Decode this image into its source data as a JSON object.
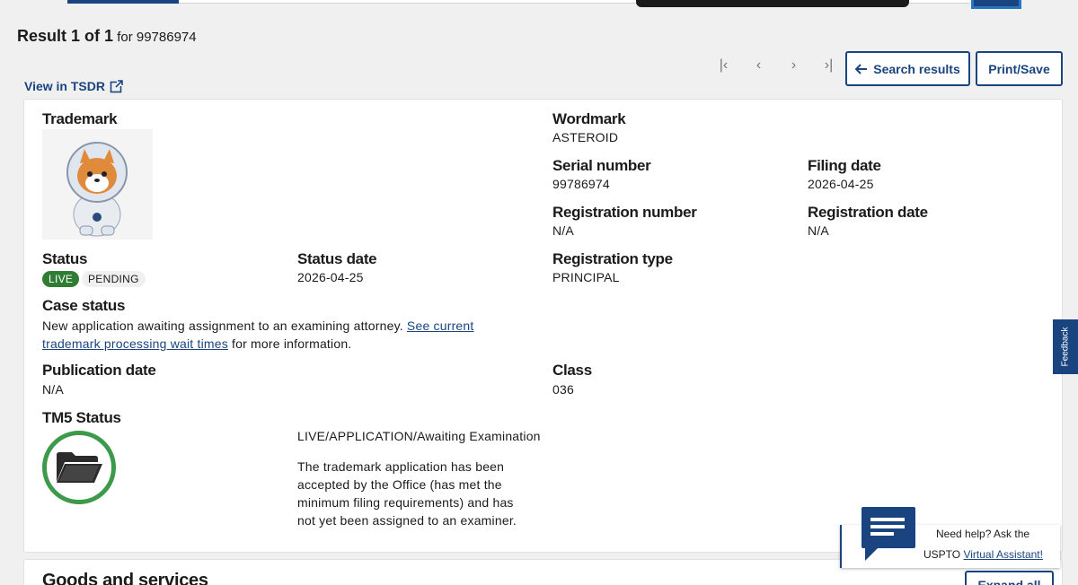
{
  "header": {
    "result_prefix": "Result 1 of 1",
    "result_for": "for 99786974"
  },
  "pager": {
    "first_icon": "first-page-icon",
    "prev_icon": "chevron-left-icon",
    "next_icon": "chevron-right-icon",
    "last_icon": "last-page-icon"
  },
  "actions": {
    "search_results_label": "Search results",
    "print_save_label": "Print/Save",
    "view_in_tsdr_label": "View in TSDR"
  },
  "trademark": {
    "trademark_label": "Trademark",
    "wordmark_label": "Wordmark",
    "wordmark_value": "ASTEROID",
    "serial_label": "Serial number",
    "serial_value": "99786974",
    "filing_label": "Filing date",
    "filing_value": "2026-04-25",
    "reg_number_label": "Registration number",
    "reg_number_value": "N/A",
    "reg_date_label": "Registration date",
    "reg_date_value": "N/A",
    "status_label": "Status",
    "status_live": "LIVE",
    "status_pending": "PENDING",
    "status_date_label": "Status date",
    "status_date_value": "2026-04-25",
    "reg_type_label": "Registration type",
    "reg_type_value": "PRINCIPAL",
    "case_status_label": "Case status",
    "case_status_text": "New application awaiting assignment to an examining attorney.",
    "case_status_link": "See current trademark processing wait times",
    "case_status_suffix": "for more information.",
    "pub_date_label": "Publication date",
    "pub_date_value": "N/A",
    "class_label": "Class",
    "class_value": "036",
    "tm5_label": "TM5 Status",
    "tm5_status": "LIVE/APPLICATION/Awaiting Examination",
    "tm5_description": "The trademark application has been accepted by the Office (has met the minimum filing requirements) and has not yet been assigned to an examiner."
  },
  "goods": {
    "title": "Goods and services",
    "expand_label": "Expand all"
  },
  "feedback": {
    "label": "Feedback"
  },
  "assistant": {
    "line1": "Need help? Ask the",
    "line2_prefix": "USPTO",
    "line2_link": "Virtual Assistant!"
  },
  "colors": {
    "brand": "#1a4480",
    "live_badge": "#2e7d32",
    "tm5_ring": "#3d9a4b"
  }
}
